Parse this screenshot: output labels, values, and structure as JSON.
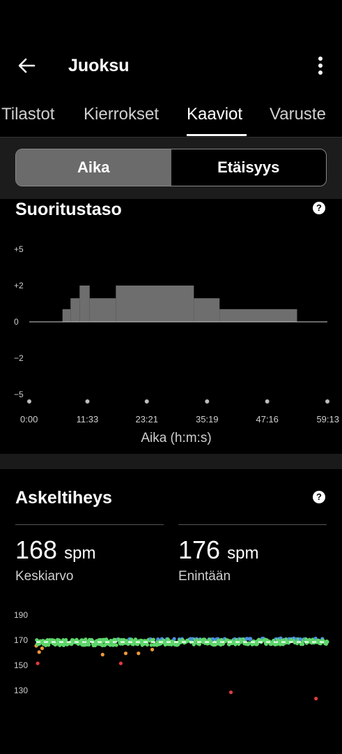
{
  "header": {
    "title": "Juoksu",
    "back_icon": "arrow-left-icon",
    "more_icon": "more-vert-icon"
  },
  "tabs": [
    {
      "label": "Tilastot",
      "active": false
    },
    {
      "label": "Kierrokset",
      "active": false
    },
    {
      "label": "Kaaviot",
      "active": true
    },
    {
      "label": "Varuste",
      "active": false
    }
  ],
  "segmented": {
    "options": [
      "Aika",
      "Etäisyys"
    ],
    "selected": "Aika"
  },
  "performance": {
    "title": "Suoritustaso",
    "help_icon": "help-icon",
    "help_glyph": "?",
    "chart_data": {
      "type": "area",
      "y_ticks": [
        "+5",
        "+2",
        "0",
        "−2",
        "−5"
      ],
      "ylim": [
        -5,
        5
      ],
      "x_ticks": [
        "0:00",
        "11:33",
        "23:21",
        "35:19",
        "47:16",
        "59:13"
      ],
      "xlabel": "Aika (h:m:s)",
      "x_minutes": [
        0,
        11.55,
        23.35,
        35.32,
        47.27,
        59.22
      ],
      "steps": [
        {
          "from": 6.6,
          "to": 8.2,
          "value": 0.7
        },
        {
          "from": 8.2,
          "to": 10.0,
          "value": 1.3
        },
        {
          "from": 10.0,
          "to": 12.0,
          "value": 2.0
        },
        {
          "from": 12.0,
          "to": 17.2,
          "value": 1.3
        },
        {
          "from": 17.2,
          "to": 32.7,
          "value": 2.0
        },
        {
          "from": 32.7,
          "to": 37.8,
          "value": 1.3
        },
        {
          "from": 37.8,
          "to": 53.2,
          "value": 0.7
        }
      ],
      "fill": "#6e6e6e"
    }
  },
  "cadence": {
    "title": "Askeltiheys",
    "help_icon": "help-icon",
    "help_glyph": "?",
    "avg_value": "168",
    "avg_unit": "spm",
    "avg_label": "Keskiarvo",
    "max_value": "176",
    "max_unit": "spm",
    "max_label": "Enintään",
    "chart_data": {
      "type": "scatter",
      "y_ticks": [
        "190",
        "170",
        "150",
        "130"
      ],
      "ylim": [
        120,
        195
      ],
      "xlim": [
        0,
        59.22
      ],
      "avg_line": 168,
      "colors": {
        "blue": "#4a8fe0",
        "green": "#5ed66b",
        "orange": "#f2993a",
        "red": "#e23b3b",
        "avg": "#ffffff"
      },
      "outliers": [
        {
          "x": 0.3,
          "y": 151,
          "color": "red"
        },
        {
          "x": 0.6,
          "y": 160,
          "color": "orange"
        },
        {
          "x": 1.2,
          "y": 163,
          "color": "orange"
        },
        {
          "x": 13.5,
          "y": 158,
          "color": "orange"
        },
        {
          "x": 17.2,
          "y": 151,
          "color": "red"
        },
        {
          "x": 18.2,
          "y": 159,
          "color": "orange"
        },
        {
          "x": 20.8,
          "y": 159,
          "color": "orange"
        },
        {
          "x": 23.6,
          "y": 162,
          "color": "orange"
        },
        {
          "x": 39.6,
          "y": 128,
          "color": "red"
        },
        {
          "x": 56.9,
          "y": 123,
          "color": "red"
        }
      ]
    }
  }
}
